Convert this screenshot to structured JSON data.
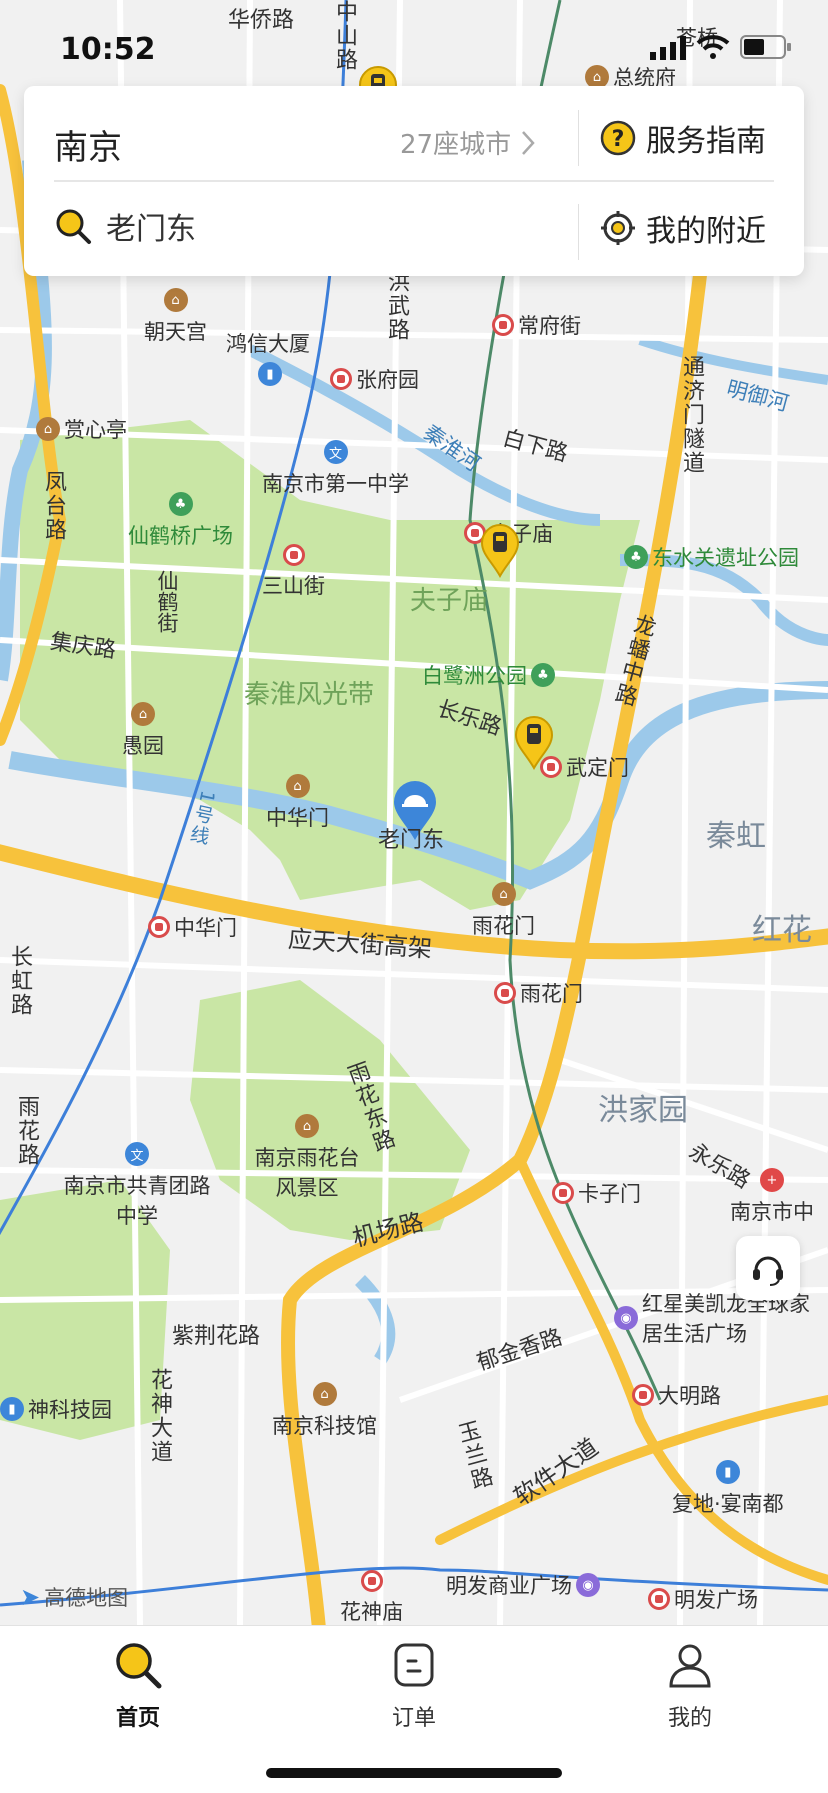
{
  "status_bar": {
    "time": "10:52"
  },
  "search_card": {
    "city": "南京",
    "city_count": "27座城市",
    "service_guide": "服务指南",
    "location": "老门东",
    "nearby": "我的附近"
  },
  "map": {
    "attribution": "高德地图",
    "selected_location": "老门东",
    "district_labels": [
      "秦虹",
      "红花",
      "洪家园"
    ],
    "park_labels": [
      "夫子庙",
      "秦淮风光带"
    ],
    "roads": [
      "华侨路",
      "中山路",
      "白下路",
      "通济门隧道",
      "洪武路",
      "凤台路",
      "集庆路",
      "长乐路",
      "龙蟠中路",
      "应天大街高架",
      "雨花东路",
      "机场路",
      "紫荆花路",
      "花神大道",
      "郁金香路",
      "玉兰路",
      "软件大道",
      "永乐路",
      "长虹路",
      "雨花路",
      "1号线",
      "秦淮河",
      "明御河"
    ],
    "metro_stations": [
      "常府街",
      "张府园",
      "夫子庙",
      "三山街",
      "武定门",
      "中华门",
      "雨花门",
      "卡子门",
      "大明路",
      "明发广场",
      "花神庙"
    ],
    "pois": [
      "总统府",
      "朝天宫",
      "鸿信大厦",
      "赏心亭",
      "南京市第一中学",
      "仙鹤桥广场",
      "东水关遗址公园",
      "白鹭洲公园",
      "愚园",
      "中华门",
      "雨花门",
      "南京雨花台风景区",
      "南京市共青团路中学",
      "南京科技馆",
      "红星美凯龙全球家居生活广场",
      "复地·宴南都",
      "明发商业广场",
      "南京市中",
      "仙鹤街",
      "神科技园",
      "苍桥"
    ]
  },
  "tab_bar": {
    "items": [
      {
        "label": "首页",
        "active": true,
        "icon": "home-search-icon"
      },
      {
        "label": "订单",
        "active": false,
        "icon": "order-icon"
      },
      {
        "label": "我的",
        "active": false,
        "icon": "profile-icon"
      }
    ]
  },
  "colors": {
    "accent": "#f5c518",
    "park": "#c9e6a5",
    "water": "#9cc9ea",
    "highway": "#f7c23c"
  }
}
